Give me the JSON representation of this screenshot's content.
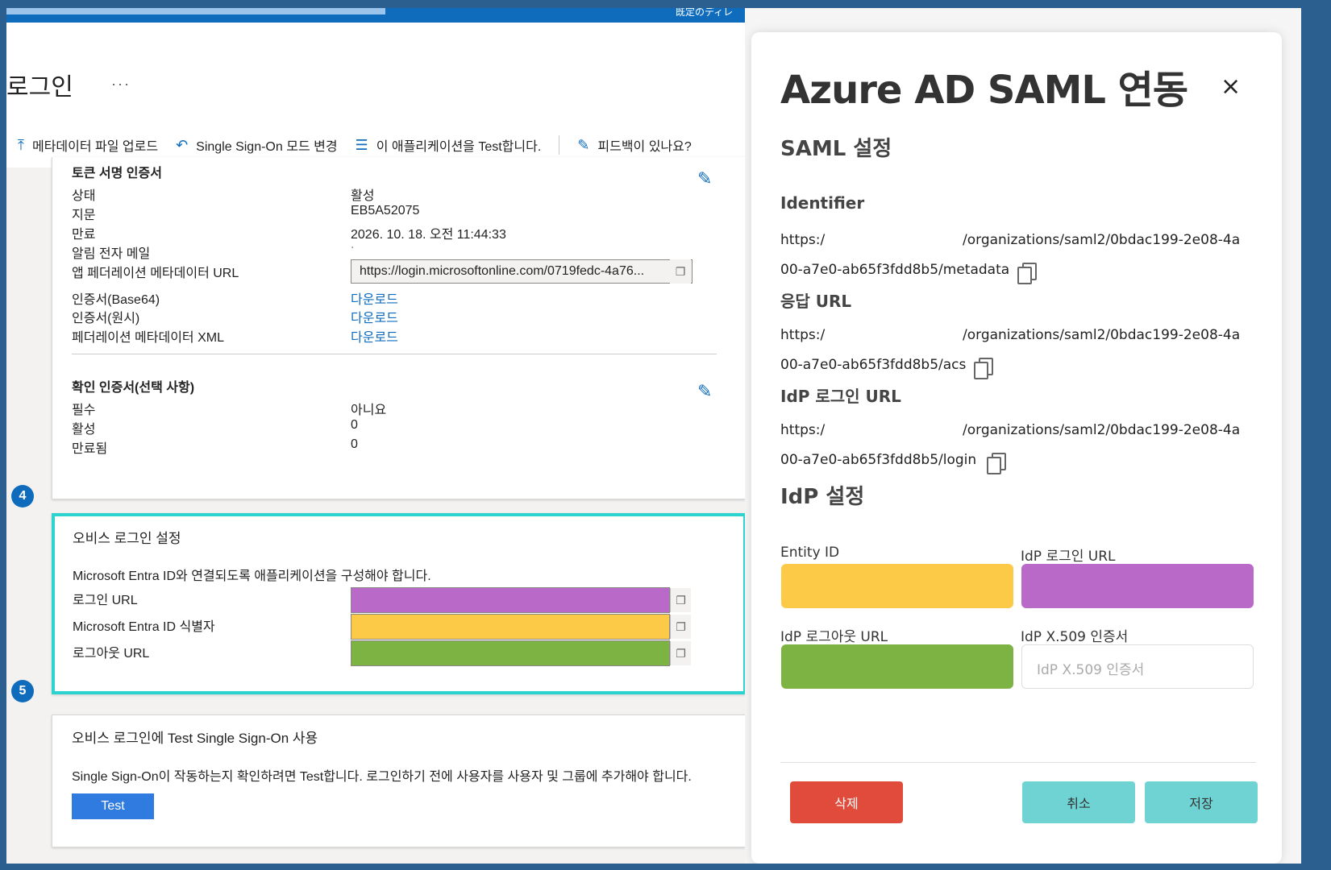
{
  "left": {
    "topbar_clipped": "既定のディレ",
    "page_title": "로그인",
    "more": "···",
    "toolbar": [
      {
        "icon": "upload-icon",
        "label": "메타데이터 파일 업로드"
      },
      {
        "icon": "undo-icon",
        "label": "Single Sign-On 모드 변경"
      },
      {
        "icon": "list-icon",
        "label": "이 애플리케이션을 Test합니다."
      },
      {
        "icon": "feedback-icon",
        "label": "피드백이 있나요?"
      }
    ],
    "cert": {
      "title": "토큰 서명 인증서",
      "rows": [
        {
          "label": "상태",
          "value": "활성"
        },
        {
          "label": "지문",
          "value": "EB5A52075"
        },
        {
          "label": "만료",
          "value": "2026. 10. 18. 오전 11:44:33"
        },
        {
          "label": "알림 전자 메일",
          "value": "."
        }
      ],
      "metadata_label": "앱 페더레이션 메타데이터 URL",
      "metadata_url": "https://login.microsoftonline.com/0719fedc-4a76...",
      "downloads": [
        {
          "label": "인증서(Base64)",
          "link": "다운로드"
        },
        {
          "label": "인증서(원시)",
          "link": "다운로드"
        },
        {
          "label": "페더레이션 메타데이터 XML",
          "link": "다운로드"
        }
      ]
    },
    "verify": {
      "title": "확인 인증서(선택 사항)",
      "rows": [
        {
          "label": "필수",
          "value": "아니요"
        },
        {
          "label": "활성",
          "value": "0"
        },
        {
          "label": "만료됨",
          "value": "0"
        }
      ]
    },
    "step4": {
      "num": "4",
      "title": "오비스 로그인 설정",
      "desc": "Microsoft Entra ID와 연결되도록 애플리케이션을 구성해야 합니다.",
      "fields": [
        {
          "label": "로그인 URL",
          "color": "#b96ac9"
        },
        {
          "label": "Microsoft Entra ID 식별자",
          "color": "#fdca47"
        },
        {
          "label": "로그아웃 URL",
          "color": "#7cb342"
        }
      ]
    },
    "step5": {
      "num": "5",
      "title": "오비스 로그인에 Test Single Sign-On 사용",
      "desc": "Single Sign-On이 작동하는지 확인하려면 Test합니다. 로그인하기 전에 사용자를 사용자 및 그룹에 추가해야 합니다.",
      "button": "Test"
    }
  },
  "modal": {
    "title": "Azure AD SAML 연동",
    "close": "×",
    "saml_heading": "SAML 설정",
    "saml_items": [
      {
        "label": "Identifier",
        "url_a": "https:/",
        "url_b": "/organizations/saml2/0bdac199-2e08-4a",
        "url_c": "00-a7e0-ab65f3fdd8b5/metadata"
      },
      {
        "label": "응답 URL",
        "url_a": "https:/",
        "url_b": "/organizations/saml2/0bdac199-2e08-4a",
        "url_c": "00-a7e0-ab65f3fdd8b5/acs"
      },
      {
        "label": "IdP 로그인 URL",
        "url_a": "https:/",
        "url_b": "/organizations/saml2/0bdac199-2e08-4a",
        "url_c": "00-a7e0-ab65f3fdd8b5/login"
      }
    ],
    "idp_heading": "IdP 설정",
    "idp_fields": [
      {
        "label": "Entity ID",
        "color": "#fdca47",
        "placeholder": ""
      },
      {
        "label": "IdP 로그인 URL",
        "color": "#b96ac9",
        "placeholder": ""
      },
      {
        "label": "IdP 로그아웃 URL",
        "color": "#7cb342",
        "placeholder": ""
      },
      {
        "label": "IdP X.509 인증서",
        "color": "",
        "placeholder": "IdP X.509 인증서"
      }
    ],
    "buttons": {
      "delete": "삭제",
      "cancel": "취소",
      "save": "저장"
    }
  }
}
